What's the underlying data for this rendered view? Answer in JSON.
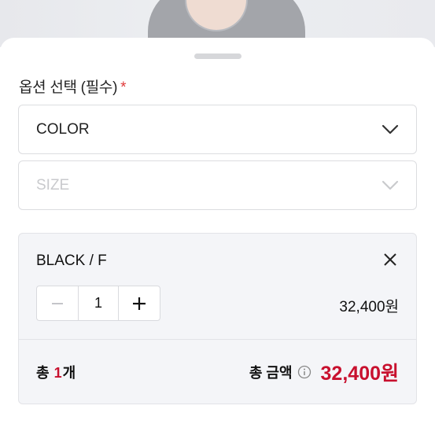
{
  "option_section": {
    "title": "옵션 선택 (필수)",
    "required_mark": "*"
  },
  "selects": {
    "color": {
      "label": "COLOR",
      "icon": "chevron-down-icon"
    },
    "size": {
      "label": "SIZE",
      "icon": "chevron-down-icon",
      "disabled": true
    }
  },
  "selected_option": {
    "name": "BLACK / F",
    "quantity": "1",
    "minus": "−",
    "plus": "+",
    "price": "32,400원"
  },
  "total": {
    "count_prefix": "총 ",
    "count_num": "1",
    "count_suffix": "개",
    "amount_label": "총 금액",
    "amount": "32,400원"
  },
  "colors": {
    "accent": "#c8102e",
    "required": "#e03a3a",
    "selected_bg": "#f4f5f8"
  }
}
